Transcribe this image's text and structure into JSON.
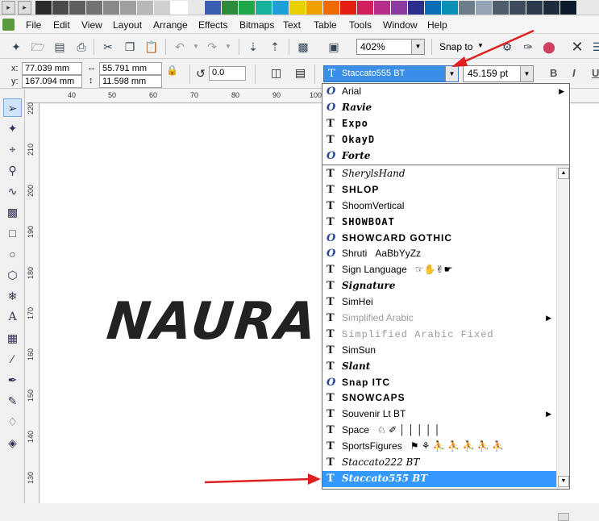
{
  "palette": {
    "colors": [
      "#2b2b2b",
      "#4a4a4a",
      "#5e5e5e",
      "#737373",
      "#8a8a8a",
      "#a0a0a0",
      "#b8b8b8",
      "#d0d0d0",
      "#ffffff",
      "#e8e8e8",
      "#3b5fb0",
      "#2e8b3c",
      "#1ea84a",
      "#18b39d",
      "#1f9fd8",
      "#e8d000",
      "#f0a000",
      "#ef6a00",
      "#e32012",
      "#d51e5e",
      "#b82d8c",
      "#8c3ba0",
      "#2d2d8c",
      "#0a6eb8",
      "#0a8fb8",
      "#6c7d8c",
      "#94a4b4",
      "#4d5d6c",
      "#3c4c5c",
      "#2c3c4c",
      "#1c2c3c",
      "#0c1c2c"
    ]
  },
  "menu": [
    "File",
    "Edit",
    "View",
    "Layout",
    "Arrange",
    "Effects",
    "Bitmaps",
    "Text",
    "Table",
    "Tools",
    "Window",
    "Help"
  ],
  "toolbar": {
    "zoom": "402%",
    "snap_label": "Snap to"
  },
  "propbar": {
    "x_label": "x:",
    "x_value": "77.039 mm",
    "y_label": "y:",
    "y_value": "167.094 mm",
    "w_value": "55.791 mm",
    "h_value": "11.598 mm",
    "angle": "0.0",
    "font_name": "Staccato555 BT",
    "font_size": "45.159 pt",
    "bold": "B",
    "italic": "I",
    "underline": "U"
  },
  "ruler": {
    "h_ticks": [
      "40",
      "50",
      "60",
      "70",
      "80",
      "90",
      "100"
    ],
    "v_ticks": [
      "220",
      "210",
      "200",
      "190",
      "180",
      "170",
      "160",
      "150",
      "140",
      "130"
    ]
  },
  "canvas": {
    "text": "NAURA"
  },
  "font_list": {
    "recent": [
      {
        "name": "Arial",
        "type": "ot",
        "submenu": true
      },
      {
        "name": "Ravie",
        "type": "ot",
        "submenu": false
      },
      {
        "name": "Expo",
        "type": "tt",
        "submenu": false
      },
      {
        "name": "OkayD",
        "type": "tt",
        "submenu": false
      },
      {
        "name": "Forte",
        "type": "ot",
        "submenu": false
      }
    ],
    "all": [
      {
        "name": "SherylsHand",
        "type": "tt",
        "style": "fancy3",
        "submenu": false,
        "sample": ""
      },
      {
        "name": "SHLOP",
        "type": "tt",
        "style": "heavy",
        "submenu": false,
        "sample": ""
      },
      {
        "name": "ShoomVertical",
        "type": "tt",
        "style": "",
        "submenu": false,
        "sample": ""
      },
      {
        "name": "SHOWBOAT",
        "type": "tt",
        "style": "fancy2",
        "submenu": false,
        "sample": ""
      },
      {
        "name": "SHOWCARD GOTHIC",
        "type": "ot",
        "style": "heavy",
        "submenu": false,
        "sample": ""
      },
      {
        "name": "Shruti",
        "type": "ot",
        "style": "",
        "submenu": false,
        "sample": "AaBbYyZz"
      },
      {
        "name": "Sign Language",
        "type": "tt",
        "style": "",
        "submenu": false,
        "sample": "☞✋✌☛"
      },
      {
        "name": "Signature",
        "type": "tt",
        "style": "fancy1",
        "submenu": false,
        "sample": ""
      },
      {
        "name": "SimHei",
        "type": "tt",
        "style": "",
        "submenu": false,
        "sample": ""
      },
      {
        "name": "Simplified Arabic",
        "type": "tt",
        "style": "grey",
        "submenu": true,
        "sample": ""
      },
      {
        "name": "Simplified Arabic Fixed",
        "type": "tt",
        "style": "mono",
        "submenu": false,
        "sample": ""
      },
      {
        "name": "SimSun",
        "type": "tt",
        "style": "",
        "submenu": false,
        "sample": ""
      },
      {
        "name": "Slant",
        "type": "tt",
        "style": "fancy1",
        "submenu": false,
        "sample": ""
      },
      {
        "name": "Snap ITC",
        "type": "ot",
        "style": "heavy",
        "submenu": false,
        "sample": ""
      },
      {
        "name": "SNOWCAPS",
        "type": "tt",
        "style": "heavy",
        "submenu": false,
        "sample": ""
      },
      {
        "name": "Souvenir Lt BT",
        "type": "tt",
        "style": "",
        "submenu": true,
        "sample": ""
      },
      {
        "name": "Space",
        "type": "tt",
        "style": "",
        "submenu": false,
        "sample": "♘ ✐ │ │ │ │ │"
      },
      {
        "name": "SportsFigures",
        "type": "tt",
        "style": "",
        "submenu": false,
        "sample": "⚑ ⚘ ⛹ ⛹ ⛹ ⛹ ⛹"
      },
      {
        "name": "Staccato222 BT",
        "type": "tt",
        "style": "fancy3",
        "submenu": false,
        "sample": ""
      },
      {
        "name": "Staccato555 BT",
        "type": "tt",
        "style": "fancy1",
        "submenu": false,
        "sample": "",
        "selected": true
      }
    ]
  }
}
